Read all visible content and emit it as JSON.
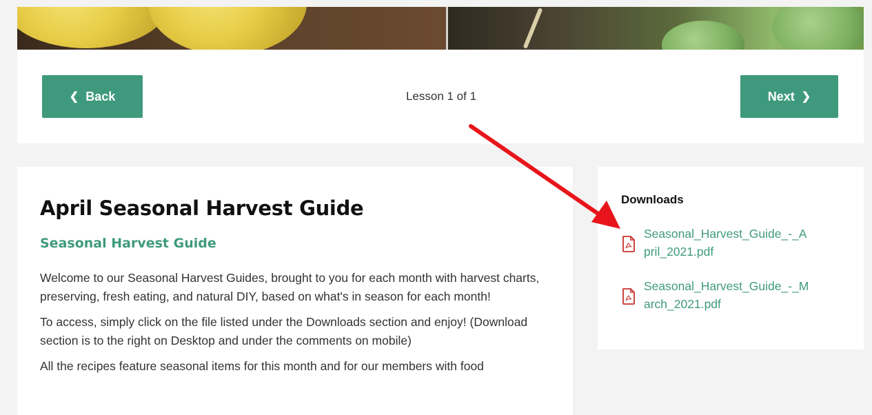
{
  "navigation": {
    "back_label": "Back",
    "next_label": "Next",
    "lesson_counter": "Lesson 1 of 1"
  },
  "content": {
    "title": "April Seasonal Harvest Guide",
    "subtitle": "Seasonal Harvest Guide",
    "paragraphs": [
      "Welcome to our Seasonal Harvest Guides, brought to you for each month with harvest charts, preserving, fresh eating, and natural DIY, based on what's in season for each month!",
      "To access, simply click on the file listed under the Downloads section and enjoy! (Download section is to the right on Desktop and under the comments on mobile)",
      "All the recipes feature seasonal items for this month and for our members with food"
    ]
  },
  "downloads": {
    "title": "Downloads",
    "files": [
      {
        "name": "Seasonal_Harvest_Guide_-_April_2021.pdf",
        "icon": "pdf-file-icon"
      },
      {
        "name": "Seasonal_Harvest_Guide_-_March_2021.pdf",
        "icon": "pdf-file-icon"
      }
    ]
  },
  "colors": {
    "accent": "#3f9a7d",
    "pdf_icon": "#c8302e",
    "annotation_arrow": "#e8141b",
    "page_background": "#f3f3f3"
  }
}
